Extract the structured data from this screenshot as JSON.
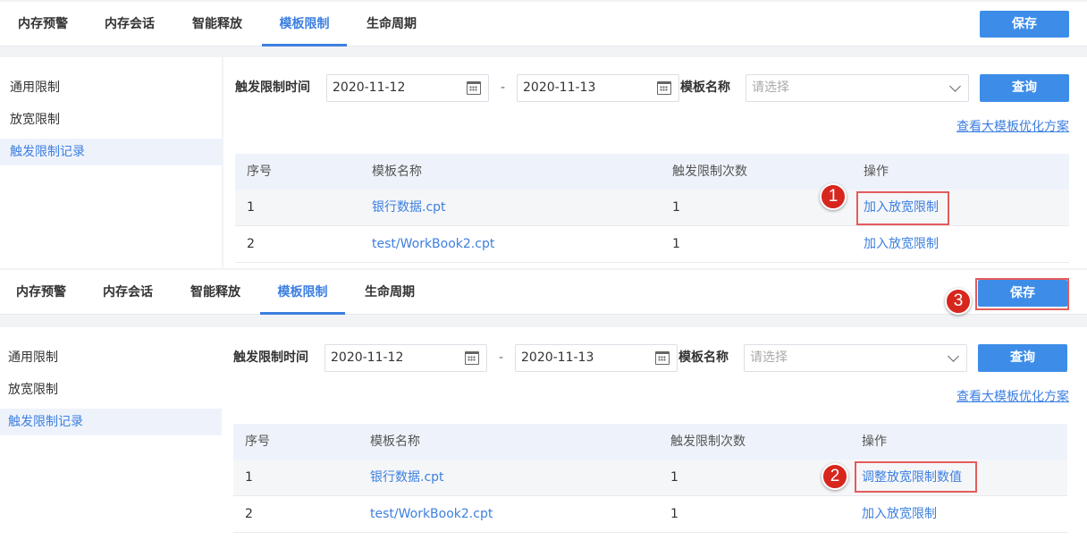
{
  "panels": [
    {
      "tabs": [
        "内存预警",
        "内存会话",
        "智能释放",
        "模板限制",
        "生命周期"
      ],
      "save_label": "保存",
      "sidebar": [
        "通用限制",
        "放宽限制",
        "触发限制记录"
      ],
      "filter": {
        "time_label": "触发限制时间",
        "date_start": "2020-11-12",
        "date_sep": "-",
        "date_end": "2020-11-13",
        "template_label": "模板名称",
        "template_placeholder": "请选择",
        "query_label": "查询"
      },
      "optimize_link": "查看大模板优化方案",
      "table": {
        "headers": [
          "序号",
          "模板名称",
          "触发限制次数",
          "操作"
        ],
        "rows": [
          {
            "idx": "1",
            "name": "银行数据.cpt",
            "count": "1",
            "action": "加入放宽限制"
          },
          {
            "idx": "2",
            "name": "test/WorkBook2.cpt",
            "count": "1",
            "action": "加入放宽限制"
          }
        ]
      },
      "badge": "1"
    },
    {
      "tabs": [
        "内存预警",
        "内存会话",
        "智能释放",
        "模板限制",
        "生命周期"
      ],
      "save_label": "保存",
      "sidebar": [
        "通用限制",
        "放宽限制",
        "触发限制记录"
      ],
      "filter": {
        "time_label": "触发限制时间",
        "date_start": "2020-11-12",
        "date_sep": "-",
        "date_end": "2020-11-13",
        "template_label": "模板名称",
        "template_placeholder": "请选择",
        "query_label": "查询"
      },
      "optimize_link": "查看大模板优化方案",
      "table": {
        "headers": [
          "序号",
          "模板名称",
          "触发限制次数",
          "操作"
        ],
        "rows": [
          {
            "idx": "1",
            "name": "银行数据.cpt",
            "count": "1",
            "action": "调整放宽限制数值"
          },
          {
            "idx": "2",
            "name": "test/WorkBook2.cpt",
            "count": "1",
            "action": "加入放宽限制"
          }
        ]
      },
      "badge_action": "2",
      "badge_save": "3"
    }
  ],
  "colors": {
    "accent": "#3d7fe0",
    "button": "#3d8de8",
    "highlight": "#e45b5b",
    "badge": "#d7261e"
  }
}
